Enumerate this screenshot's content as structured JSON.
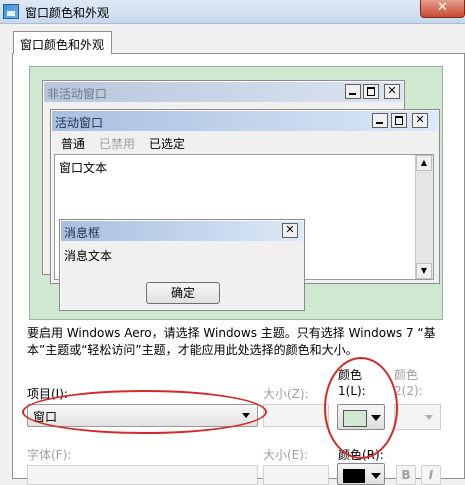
{
  "window": {
    "title": "窗口颜色和外观",
    "close_label": "✕"
  },
  "tab": {
    "label": "窗口颜色和外观"
  },
  "preview": {
    "inactive_title": "非活动窗口",
    "active_title": "活动窗口",
    "menu": [
      "普通",
      "已禁用",
      "已选定"
    ],
    "window_text": "窗口文本",
    "message_title": "消息框",
    "message_text": "消息文本",
    "ok_label": "确定",
    "background_color": "#cfe8cf"
  },
  "info_text": "要启用 Windows Aero，请选择 Windows 主题。只有选择 Windows 7 “基本”主题或“轻松访问”主题，才能应用此处选择的颜色和大小。",
  "item": {
    "label": "项目(I):",
    "value": "窗口"
  },
  "size": {
    "label": "大小(Z):"
  },
  "color1": {
    "label_top": "颜色",
    "label_bottom": "1(L):",
    "value": "#cfe8cf"
  },
  "color2": {
    "label_top": "颜色",
    "label_bottom": "2(2):"
  },
  "font": {
    "label": "字体(F):"
  },
  "font_size": {
    "label": "大小(E):"
  },
  "font_color": {
    "label": "颜色(R):",
    "value": "#000000"
  },
  "font_buttons": [
    "B",
    "I"
  ],
  "accent_colors": {
    "highlight_ellipse": "#d4292b",
    "close_button": "#c84a30"
  }
}
